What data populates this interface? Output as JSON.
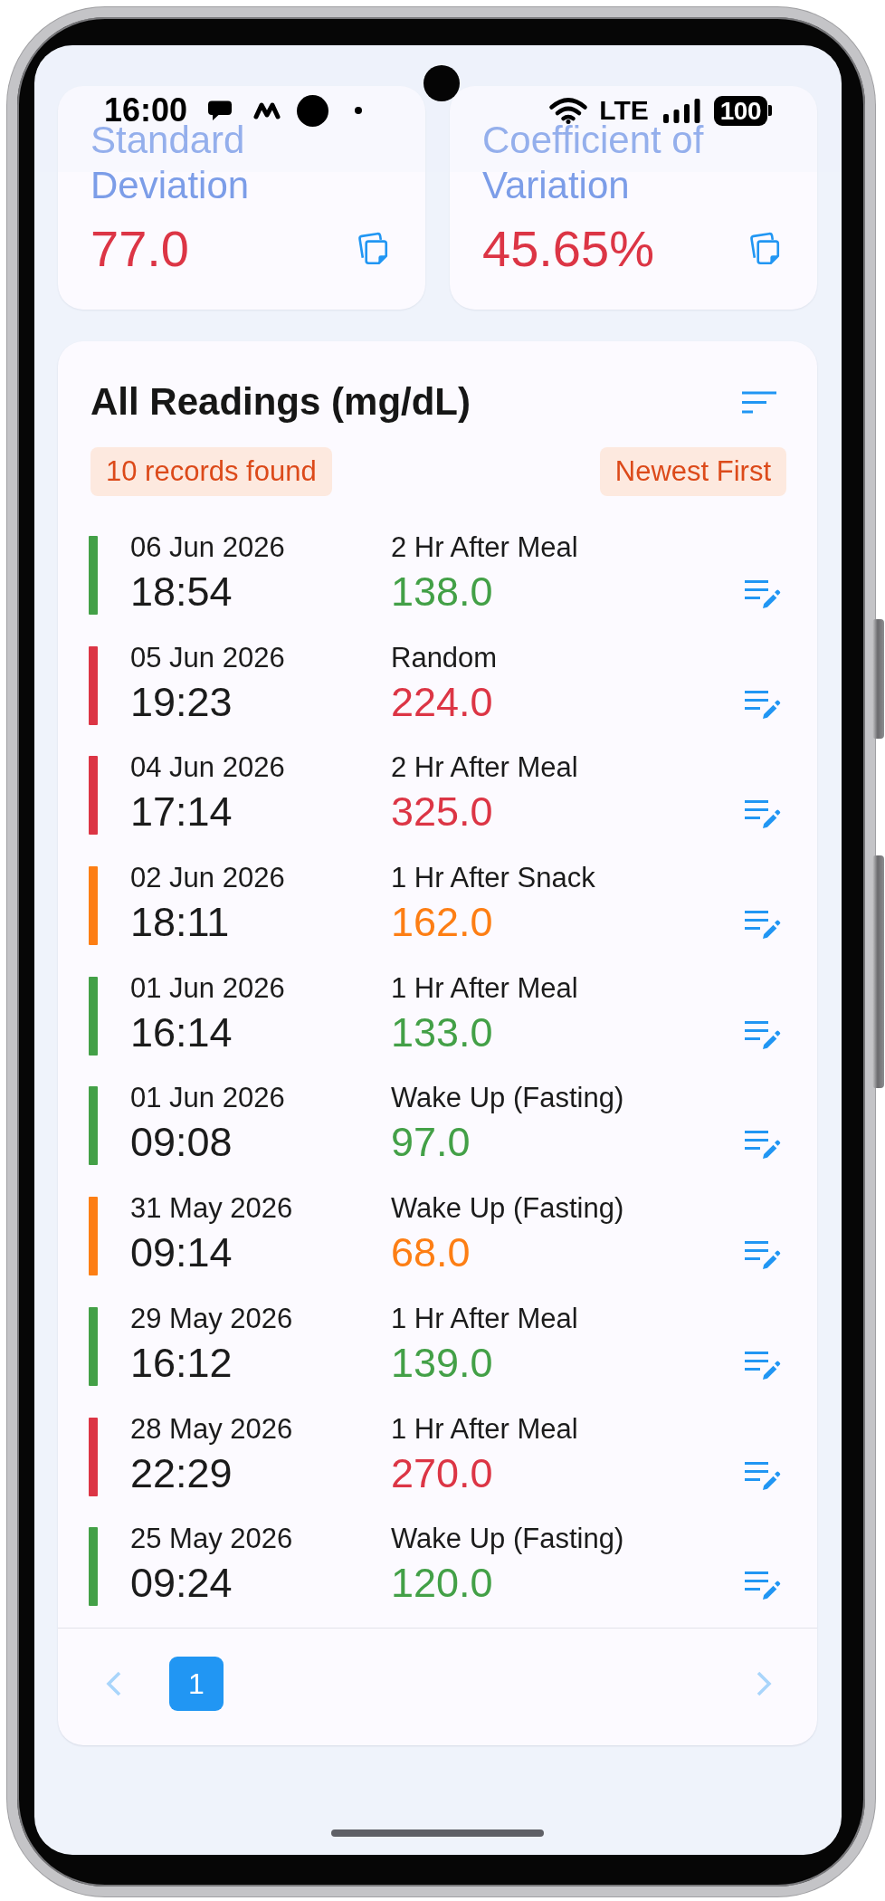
{
  "status_bar": {
    "time": "16:00",
    "network": "LTE",
    "battery": "100"
  },
  "stats": [
    {
      "label": "Standard Deviation",
      "value": "77.0"
    },
    {
      "label": "Coefficient of Variation",
      "value": "45.65%"
    }
  ],
  "readings": {
    "title": "All Readings (mg/dL)",
    "count": "10 records found",
    "sort_order": "Newest First",
    "rows": [
      {
        "date": "06 Jun 2026",
        "time": "18:54",
        "type": "2 Hr After Meal",
        "value": "138.0",
        "color": "#43a047"
      },
      {
        "date": "05 Jun 2026",
        "time": "19:23",
        "type": "Random",
        "value": "224.0",
        "color": "#dc3545"
      },
      {
        "date": "04 Jun 2026",
        "time": "17:14",
        "type": "2 Hr After Meal",
        "value": "325.0",
        "color": "#dc3545"
      },
      {
        "date": "02 Jun 2026",
        "time": "18:11",
        "type": "1 Hr After Snack",
        "value": "162.0",
        "color": "#fd7e14"
      },
      {
        "date": "01 Jun 2026",
        "time": "16:14",
        "type": "1 Hr After Meal",
        "value": "133.0",
        "color": "#43a047"
      },
      {
        "date": "01 Jun 2026",
        "time": "09:08",
        "type": "Wake Up (Fasting)",
        "value": "97.0",
        "color": "#43a047"
      },
      {
        "date": "31 May 2026",
        "time": "09:14",
        "type": "Wake Up (Fasting)",
        "value": "68.0",
        "color": "#fd7e14"
      },
      {
        "date": "29 May 2026",
        "time": "16:12",
        "type": "1 Hr After Meal",
        "value": "139.0",
        "color": "#43a047"
      },
      {
        "date": "28 May 2026",
        "time": "22:29",
        "type": "1 Hr After Meal",
        "value": "270.0",
        "color": "#dc3545"
      },
      {
        "date": "25 May 2026",
        "time": "09:24",
        "type": "Wake Up (Fasting)",
        "value": "120.0",
        "color": "#43a047"
      }
    ]
  },
  "pagination": {
    "previous": {
      "disabled": true
    },
    "pages": [
      {
        "label": "1",
        "selected": true
      }
    ],
    "next": {
      "disabled": true
    }
  }
}
